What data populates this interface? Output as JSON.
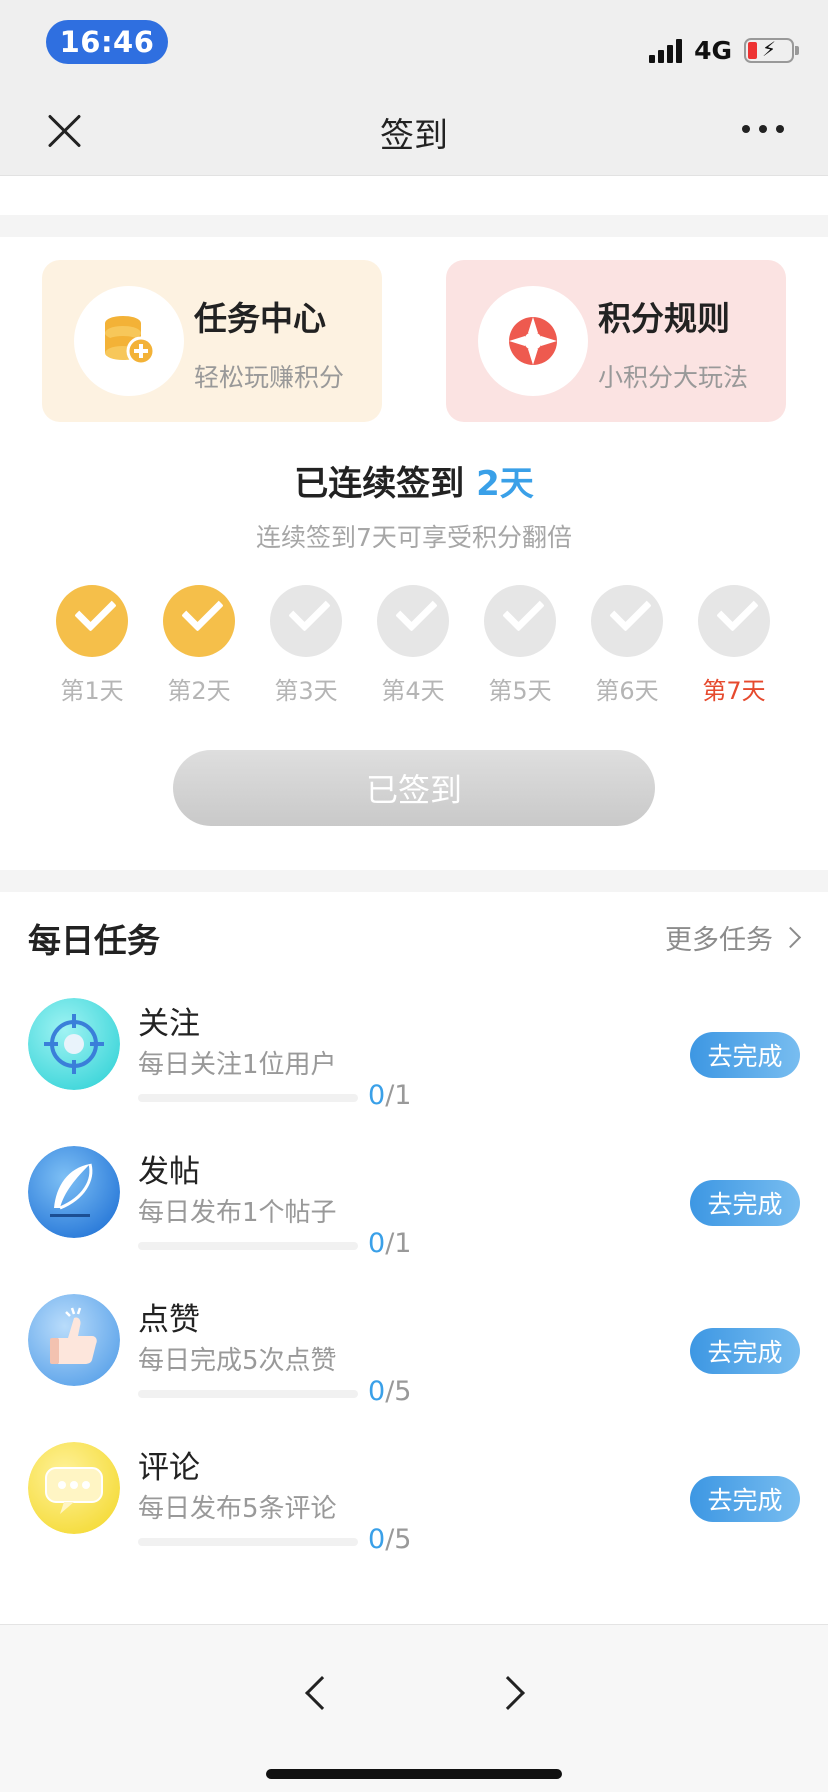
{
  "status_bar": {
    "time": "16:46",
    "network": "4G",
    "battery_level": 0.2
  },
  "header": {
    "title": "签到"
  },
  "cards": [
    {
      "title": "任务中心",
      "subtitle": "轻松玩赚积分",
      "icon": "coins-icon"
    },
    {
      "title": "积分规则",
      "subtitle": "小积分大玩法",
      "icon": "lifebuoy-icon"
    }
  ],
  "streak": {
    "prefix": "已连续签到",
    "days": "2天",
    "hint": "连续签到7天可享受积分翻倍",
    "day_labels": [
      "第1天",
      "第2天",
      "第3天",
      "第4天",
      "第5天",
      "第6天",
      "第7天"
    ],
    "completed_days": 2,
    "button_label": "已签到"
  },
  "daily_tasks": {
    "title": "每日任务",
    "more_label": "更多任务",
    "items": [
      {
        "name": "关注",
        "desc": "每日关注1位用户",
        "current": "0",
        "total": "/1",
        "progress": 0,
        "action": "去完成",
        "icon": "target-icon"
      },
      {
        "name": "发帖",
        "desc": "每日发布1个帖子",
        "current": "0",
        "total": "/1",
        "progress": 0,
        "action": "去完成",
        "icon": "feather-icon"
      },
      {
        "name": "点赞",
        "desc": "每日完成5次点赞",
        "current": "0",
        "total": "/5",
        "progress": 0,
        "action": "去完成",
        "icon": "thumbs-up-icon"
      },
      {
        "name": "评论",
        "desc": "每日发布5条评论",
        "current": "0",
        "total": "/5",
        "progress": 0,
        "action": "去完成",
        "icon": "comment-icon"
      }
    ]
  },
  "colors": {
    "accent_blue": "#3aa0e8",
    "check_done": "#f5bf4a",
    "check_pending": "#e6e6e6",
    "highlight_day": "#e64a2e"
  }
}
